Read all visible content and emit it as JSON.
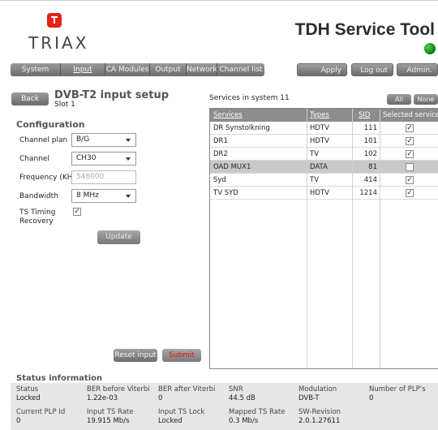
{
  "header": {
    "logo_text": "TRIAX",
    "app_title": "TDH Service Tool"
  },
  "nav": {
    "tabs": [
      "System",
      "Input",
      "CA Modules",
      "Output",
      "Network",
      "Channel list"
    ],
    "active_tab": "Input",
    "apply_label": "Apply",
    "logout_label": "Log out",
    "admin_label": "Admin."
  },
  "page": {
    "back_label": "Back",
    "title": "DVB-T2 input setup",
    "subtitle": "Slot 1"
  },
  "config": {
    "title": "Configuration",
    "channel_plan_label": "Channel plan",
    "channel_plan_value": "B/G",
    "channel_label": "Channel",
    "channel_value": "CH30",
    "frequency_label": "Frequency (KHz)",
    "frequency_value": "546000",
    "bandwidth_label": "Bandwidth",
    "bandwidth_value": "8 MHz",
    "ts_timing_label_1": "TS Timing",
    "ts_timing_label_2": "Recovery",
    "ts_timing_checked": true,
    "update_label": "Update"
  },
  "services": {
    "title": "Services in system 11",
    "all_label": "All",
    "none_label": "None",
    "headers": {
      "services": "Services",
      "types": "Types",
      "sid": "SID",
      "selected": "Selected services"
    },
    "rows": [
      {
        "name": "DR Synstolkning",
        "type": "HDTV",
        "sid": "111",
        "checked": true,
        "highlight": false
      },
      {
        "name": "DR1",
        "type": "HDTV",
        "sid": "101",
        "checked": true,
        "highlight": false
      },
      {
        "name": "DR2",
        "type": "TV",
        "sid": "102",
        "checked": true,
        "highlight": false
      },
      {
        "name": "OAD MUX1",
        "type": "DATA",
        "sid": "81",
        "checked": false,
        "highlight": true
      },
      {
        "name": "Syd",
        "type": "TV",
        "sid": "414",
        "checked": true,
        "highlight": false
      },
      {
        "name": "TV SYD",
        "type": "HDTV",
        "sid": "1214",
        "checked": true,
        "highlight": false
      }
    ]
  },
  "actions": {
    "reset_label": "Reset input",
    "submit_label": "Submit"
  },
  "status": {
    "title": "Status information",
    "row1": [
      {
        "label": "Status",
        "value": "Locked"
      },
      {
        "label": "BER before Viterbi",
        "value": "1.22e-03"
      },
      {
        "label": "BER after Viterbi",
        "value": "0"
      },
      {
        "label": "SNR",
        "value": "44.5 dB"
      },
      {
        "label": "Modulation",
        "value": "DVB-T"
      },
      {
        "label": "Number of PLP's",
        "value": "0"
      }
    ],
    "row2": [
      {
        "label": "Current PLP Id",
        "value": "0"
      },
      {
        "label": "Input TS Rate",
        "value": "19.915 Mb/s"
      },
      {
        "label": "Input TS Lock",
        "value": "Locked"
      },
      {
        "label": "Mapped TS Rate",
        "value": "0.3 Mb/s"
      },
      {
        "label": "SW-Revision",
        "value": "2.0.1.27611"
      }
    ]
  },
  "colors": {
    "brand_red": "#e2231a",
    "led_green": "#1fa51f",
    "submit_red": "#e01010"
  }
}
